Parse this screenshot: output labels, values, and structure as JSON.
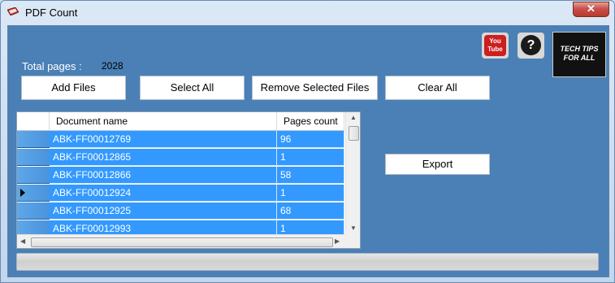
{
  "window": {
    "title": "PDF Count",
    "close_label": "✕"
  },
  "summary": {
    "total_label": "Total pages :",
    "total_value": "2028"
  },
  "toolbar": {
    "add_files": "Add Files",
    "select_all": "Select All",
    "remove_selected": "Remove Selected Files",
    "clear_all": "Clear All",
    "export": "Export"
  },
  "badges": {
    "youtube_line1": "You",
    "youtube_line2": "Tube",
    "help": "?",
    "logo_line1": "TECH TIPS",
    "logo_line2": "FOR ALL"
  },
  "grid": {
    "columns": [
      "Document name",
      "Pages count"
    ],
    "rows": [
      {
        "name": "ABK-FF00012769",
        "pages": "96"
      },
      {
        "name": "ABK-FF00012865",
        "pages": "1"
      },
      {
        "name": "ABK-FF00012866",
        "pages": "58"
      },
      {
        "name": "ABK-FF00012924",
        "pages": "1"
      },
      {
        "name": "ABK-FF00012925",
        "pages": "68"
      },
      {
        "name": "ABK-FF00012993",
        "pages": "1"
      }
    ],
    "current_row_index": 3
  },
  "progress": {
    "value": 0
  },
  "colors": {
    "client_bg": "#4a80b5",
    "selection": "#3399ff"
  }
}
